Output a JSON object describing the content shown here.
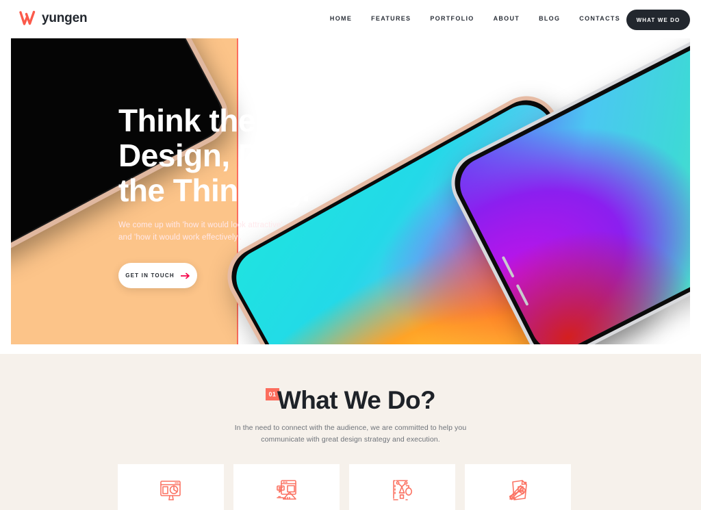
{
  "site": {
    "brand": "yungen",
    "logo_icon": "yungen-w-mark-icon"
  },
  "header": {
    "nav_items": [
      {
        "label": "HOME"
      },
      {
        "label": "FEATURES"
      },
      {
        "label": "PORTFOLIO"
      },
      {
        "label": "ABOUT"
      },
      {
        "label": "BLOG"
      },
      {
        "label": "CONTACTS"
      }
    ],
    "cta_label": "WHAT WE DO"
  },
  "hero": {
    "title_line1": "Think the",
    "title_line2": "Design, Design",
    "title_line3": "the Thinking.",
    "subtitle_line1": "We come up with 'how it would look attractive'",
    "subtitle_line2": "and 'how it would work effectively'.",
    "button_label": "GET IN TOUCH",
    "button_icon": "arrow-right-icon",
    "bands": [
      {
        "name": "crimson",
        "color": "#F5034A"
      },
      {
        "name": "coral",
        "color": "#FC6D5D"
      },
      {
        "name": "peach",
        "color": "#FCC489"
      }
    ],
    "phones": [
      {
        "name": "phone-black-left",
        "screen": "black"
      },
      {
        "name": "phone-gradient-center",
        "screen": "cyan-orange-gradient"
      },
      {
        "name": "phone-silver-right",
        "screen": "green-purple-red-gradient"
      }
    ]
  },
  "what_we_do": {
    "badge": "01",
    "title": "What We Do?",
    "subtitle_line1": "In the need to connect with the audience, we are committed to help you",
    "subtitle_line2": "communicate with great design strategy and execution.",
    "cards": [
      {
        "icon": "monitor-chart-icon"
      },
      {
        "icon": "web-design-ruler-icon"
      },
      {
        "icon": "pen-tool-icon"
      },
      {
        "icon": "document-ruler-pencil-icon"
      }
    ]
  },
  "colors": {
    "brand_red": "#F5034A",
    "coral": "#FC6D5D",
    "peach": "#FCC489",
    "dark": "#22272E",
    "cream": "#F6F1EB",
    "icon_coral": "#FB7363"
  }
}
